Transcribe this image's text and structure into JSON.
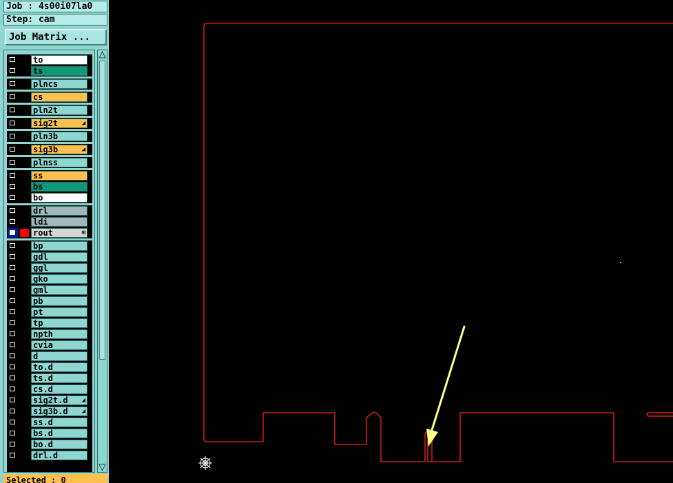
{
  "job": {
    "label": "Job : 4s00i07la0",
    "step": "Step: cam"
  },
  "toolbar": {
    "job_matrix_label": "Job Matrix ..."
  },
  "layers": [
    {
      "name": "to",
      "color": "white",
      "checked": false
    },
    {
      "name": "ts",
      "color": "green",
      "checked": false
    },
    {
      "name": "plncs",
      "color": "teal",
      "checked": false
    },
    {
      "name": "cs",
      "color": "orange",
      "checked": false
    },
    {
      "name": "pln2t",
      "color": "teal",
      "checked": false
    },
    {
      "name": "sig2t",
      "color": "orange",
      "checked": false,
      "mark": "◢"
    },
    {
      "name": "pln3b",
      "color": "teal",
      "checked": false
    },
    {
      "name": "sig3b",
      "color": "orange",
      "checked": false,
      "mark": "◢"
    },
    {
      "name": "plnss",
      "color": "teal",
      "checked": false
    },
    {
      "name": "ss",
      "color": "orange",
      "checked": false
    },
    {
      "name": "bs",
      "color": "green",
      "checked": false
    },
    {
      "name": "bo",
      "color": "white",
      "checked": false
    },
    {
      "name": "drl",
      "color": "gray",
      "checked": false
    },
    {
      "name": "ldi",
      "color": "gray",
      "checked": false
    },
    {
      "name": "rout",
      "color": "lgray",
      "checked": true,
      "swatch": "red",
      "mark": "⊞"
    },
    {
      "name": "bp",
      "color": "teal",
      "checked": false
    },
    {
      "name": "gdl",
      "color": "teal",
      "checked": false
    },
    {
      "name": "ggl",
      "color": "teal",
      "checked": false
    },
    {
      "name": "gko",
      "color": "teal",
      "checked": false
    },
    {
      "name": "gml",
      "color": "teal",
      "checked": false
    },
    {
      "name": "pb",
      "color": "teal",
      "checked": false
    },
    {
      "name": "pt",
      "color": "teal",
      "checked": false
    },
    {
      "name": "tp",
      "color": "teal",
      "checked": false
    },
    {
      "name": "npth",
      "color": "teal",
      "checked": false
    },
    {
      "name": "cvia",
      "color": "teal",
      "checked": false
    },
    {
      "name": "d",
      "color": "teal",
      "checked": false
    },
    {
      "name": "to.d",
      "color": "teal",
      "checked": false
    },
    {
      "name": "ts.d",
      "color": "teal",
      "checked": false
    },
    {
      "name": "cs.d",
      "color": "teal",
      "checked": false
    },
    {
      "name": "sig2t.d",
      "color": "teal",
      "checked": false,
      "mark": "◢"
    },
    {
      "name": "sig3b.d",
      "color": "teal",
      "checked": false,
      "mark": "◢"
    },
    {
      "name": "ss.d",
      "color": "teal",
      "checked": false
    },
    {
      "name": "bs.d",
      "color": "teal",
      "checked": false
    },
    {
      "name": "bo.d",
      "color": "teal",
      "checked": false
    },
    {
      "name": "drl.d",
      "color": "teal",
      "checked": false
    }
  ],
  "status": {
    "selected": "Selected : 0"
  },
  "colors": {
    "outline": "#ff2020",
    "arrow": "#ffff88",
    "panel": "#8fd6d0",
    "canvas": "#000000"
  },
  "icons": {
    "origin": "crosshair-origin-icon",
    "arrow": "annotation-arrow"
  }
}
